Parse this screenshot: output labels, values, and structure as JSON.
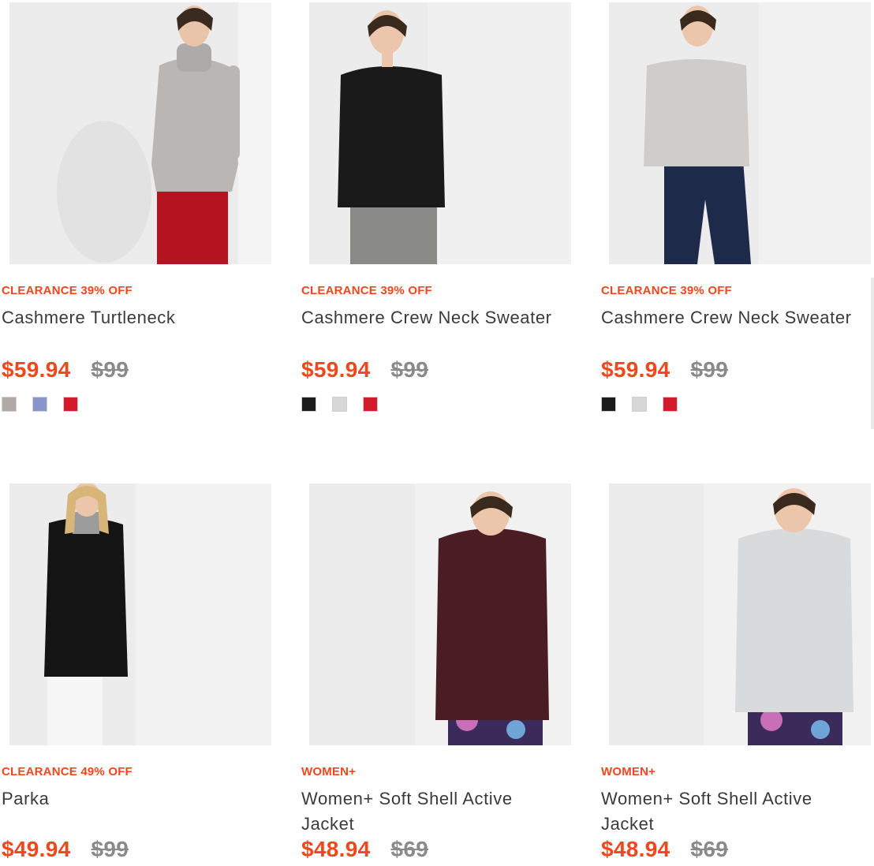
{
  "products": [
    {
      "badge": "CLEARANCE 39% OFF",
      "name": "Cashmere Turtleneck",
      "price": "$59.94",
      "original_price": "$99",
      "colors": [
        "#b3a9a3",
        "#8895c8",
        "#d31b2c"
      ],
      "image": "model-grey-turtleneck-red-pants"
    },
    {
      "badge": "CLEARANCE 39% OFF",
      "name": "Cashmere Crew Neck Sweater",
      "price": "$59.94",
      "original_price": "$99",
      "colors": [
        "#1c1c1c",
        "#d9d7d5",
        "#d31b2c"
      ],
      "image": "model-black-sweater-grey-jeans"
    },
    {
      "badge": "CLEARANCE 39% OFF",
      "name": "Cashmere Crew Neck Sweater",
      "price": "$59.94",
      "original_price": "$99",
      "colors": [
        "#1c1c1c",
        "#d9d7d5",
        "#d31b2c"
      ],
      "image": "model-light-grey-sweater-navy-pants"
    },
    {
      "badge": "CLEARANCE 49% OFF",
      "name": "Parka",
      "price": "$49.94",
      "original_price": "$99",
      "colors": [],
      "image": "model-black-long-parka"
    },
    {
      "badge": "WOMEN+",
      "name": "Women+ Soft Shell Active Jacket",
      "price": "$48.94",
      "original_price": "$69",
      "colors": [],
      "image": "model-burgundy-soft-shell-jacket"
    },
    {
      "badge": "WOMEN+",
      "name": "Women+ Soft Shell Active Jacket",
      "price": "$48.94",
      "original_price": "$69",
      "colors": [],
      "image": "model-light-grey-soft-shell-jacket"
    }
  ],
  "colors": {
    "accent": "#f2471c",
    "muted_price": "#8a8a8a",
    "text": "#3a3a3a"
  }
}
